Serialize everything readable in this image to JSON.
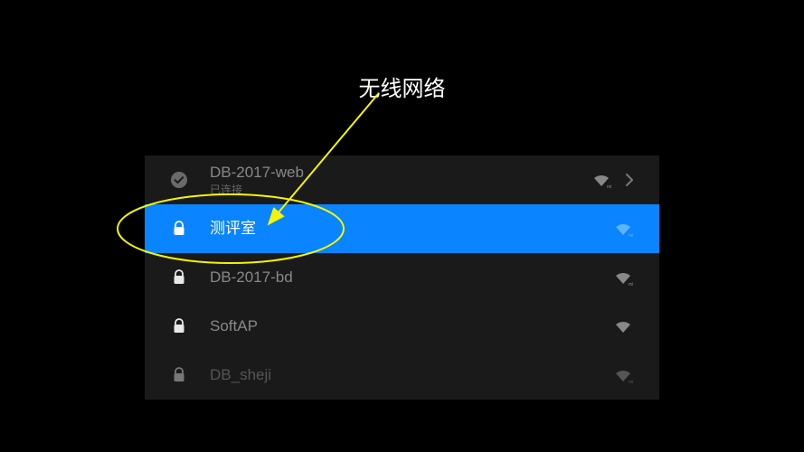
{
  "title": "无线网络",
  "networks": [
    {
      "ssid": "DB-2017-web",
      "status": "已连接",
      "connected": true,
      "secured": false,
      "selected": false,
      "hasChevron": true
    },
    {
      "ssid": "测评室",
      "status": "",
      "connected": false,
      "secured": true,
      "selected": true,
      "hasChevron": false
    },
    {
      "ssid": "DB-2017-bd",
      "status": "",
      "connected": false,
      "secured": true,
      "selected": false,
      "hasChevron": false
    },
    {
      "ssid": "SoftAP",
      "status": "",
      "connected": false,
      "secured": true,
      "selected": false,
      "hasChevron": false
    },
    {
      "ssid": "DB_sheji",
      "status": "",
      "connected": false,
      "secured": true,
      "selected": false,
      "hasChevron": false
    }
  ],
  "annotation": {
    "color": "#f5f500"
  }
}
